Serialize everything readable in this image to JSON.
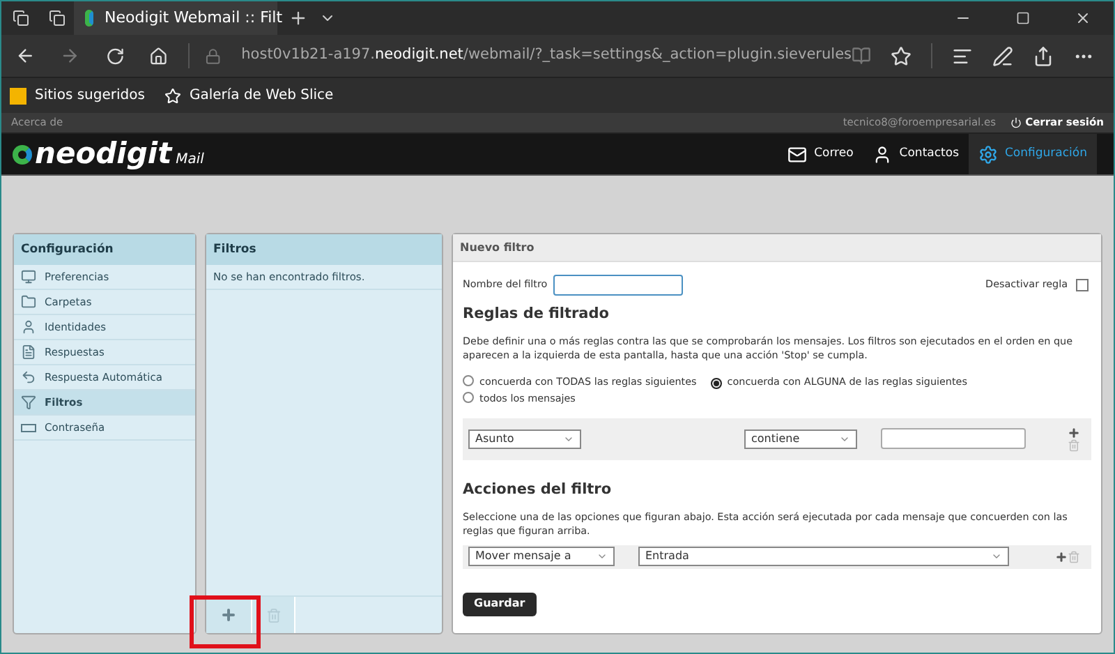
{
  "browser": {
    "tab_title": "Neodigit Webmail :: Filt",
    "url_host": "host0v1b21-a197.",
    "url_domain": "neodigit.net",
    "url_path": "/webmail/?_task=settings&_action=plugin.sieverules",
    "favorites": [
      {
        "label": "Sitios sugeridos",
        "kind": "bing"
      },
      {
        "label": "Galería de Web Slice",
        "kind": "star"
      }
    ]
  },
  "topbar": {
    "about": "Acerca de",
    "user": "tecnico8@foroempresarial.es",
    "logout": "Cerrar sesión"
  },
  "logo": {
    "name": "neodigit",
    "suffix": "Mail"
  },
  "nav": [
    {
      "label": "Correo",
      "kind": "mail",
      "selected": false
    },
    {
      "label": "Contactos",
      "kind": "person",
      "selected": false
    },
    {
      "label": "Configuración",
      "kind": "gear",
      "selected": true
    }
  ],
  "settings": {
    "title": "Configuración",
    "items": [
      {
        "label": "Preferencias",
        "kind": "monitor",
        "selected": false
      },
      {
        "label": "Carpetas",
        "kind": "folder",
        "selected": false
      },
      {
        "label": "Identidades",
        "kind": "person",
        "selected": false
      },
      {
        "label": "Respuestas",
        "kind": "doc",
        "selected": false
      },
      {
        "label": "Respuesta Automática",
        "kind": "reply",
        "selected": false
      },
      {
        "label": "Filtros",
        "kind": "funnel",
        "selected": true
      },
      {
        "label": "Contraseña",
        "kind": "password",
        "selected": false
      }
    ]
  },
  "filters": {
    "title": "Filtros",
    "empty": "No se han encontrado filtros."
  },
  "form": {
    "title": "Nuevo filtro",
    "name_label": "Nombre del filtro",
    "disable_label": "Desactivar regla",
    "disable_checked": false,
    "rules_heading": "Reglas de filtrado",
    "rules_text": "Debe definir una o más reglas contra las que se comprobarán los mensajes. Los filtros son ejecutados en el orden en que aparecen a la izquierda de esta pantalla, hasta que una acción 'Stop' se cumpla.",
    "match": [
      {
        "label": "concuerda con TODAS las reglas siguientes",
        "selected": false
      },
      {
        "label": "concuerda con ALGUNA de las reglas siguientes",
        "selected": true
      },
      {
        "label": "todos los mensajes",
        "selected": false
      }
    ],
    "rule": {
      "header": "Asunto",
      "op": "contiene"
    },
    "actions_heading": "Acciones del filtro",
    "actions_text": "Seleccione una de las opciones que figuran abajo. Esta acción será ejecutada por cada mensaje que concuerden con las reglas que figuran arriba.",
    "action": {
      "type": "Mover mensaje a",
      "folder": "Entrada"
    },
    "save": "Guardar"
  }
}
